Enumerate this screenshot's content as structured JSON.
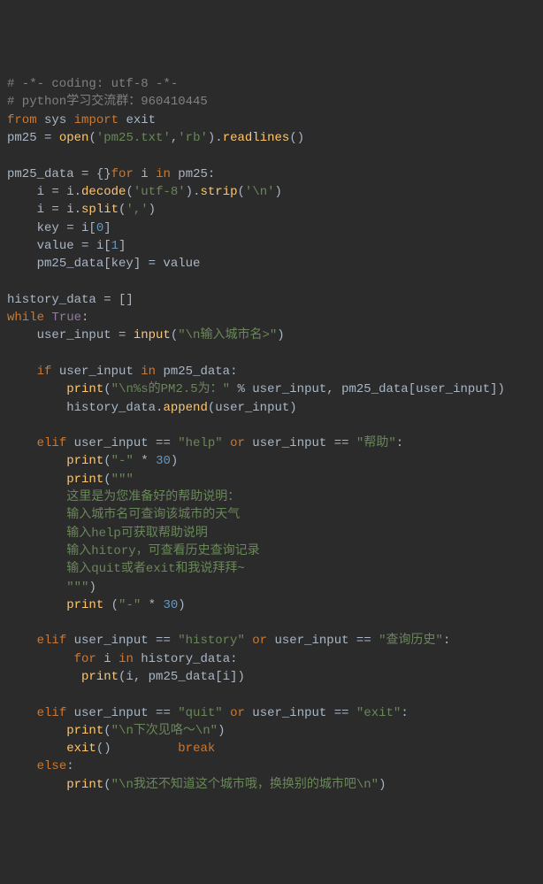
{
  "code": {
    "l01": "# -*- coding: utf-8 -*-",
    "l02": "# python学习交流群：960410445",
    "l03a": "from",
    "l03b": "sys",
    "l03c": "import",
    "l03d": "exit",
    "l04a": "pm25",
    "l04b": "=",
    "l04c": "open",
    "l04d": "'pm25.txt'",
    "l04e": ",",
    "l04f": "'rb'",
    "l04g": ").",
    "l04h": "readlines",
    "l04i": "()",
    "l06a": "pm25_data",
    "l06b": "= {}",
    "l06c": "for",
    "l06d": "i",
    "l06e": "in",
    "l06f": "pm25:",
    "l07a": "i = i.",
    "l07b": "decode",
    "l07c": "(",
    "l07d": "'utf-8'",
    "l07e": ").",
    "l07f": "strip",
    "l07g": "(",
    "l07h": "'\\n'",
    "l07i": ")",
    "l08a": "i = i.",
    "l08b": "split",
    "l08c": "(",
    "l08d": "','",
    "l08e": ")",
    "l09a": "key = i[",
    "l09b": "0",
    "l09c": "]",
    "l10a": "value = i[",
    "l10b": "1",
    "l10c": "]",
    "l11": "pm25_data[key] = value",
    "l13": "history_data = []",
    "l14a": "while",
    "l14b": "True",
    "l14c": ":",
    "l15a": "user_input = ",
    "l15b": "input",
    "l15c": "(",
    "l15d": "\"\\n输入城市名>\"",
    "l15e": ")",
    "l17a": "if",
    "l17b": "user_input",
    "l17c": "in",
    "l17d": "pm25_data:",
    "l18a": "print",
    "l18b": "(",
    "l18c": "\"\\n%s的PM2.5为：\"",
    "l18d": " % user_input, pm25_data[user_input])",
    "l19a": "history_data.",
    "l19b": "append",
    "l19c": "(user_input)",
    "l21a": "elif",
    "l21b": "user_input ==",
    "l21c": "\"help\"",
    "l21d": "or",
    "l21e": "user_input ==",
    "l21f": "\"帮助\"",
    "l21g": ":",
    "l22a": "print",
    "l22b": "(",
    "l22c": "\"-\"",
    "l22d": " * ",
    "l22e": "30",
    "l22f": ")",
    "l23a": "print",
    "l23b": "(",
    "l23c": "\"\"\"",
    "l24": "这里是为您准备好的帮助说明：",
    "l25": "输入城市名可查询该城市的天气",
    "l26": "输入help可获取帮助说明",
    "l27": "输入hitory，可查看历史查询记录",
    "l28": "输入quit或者exit和我说拜拜~",
    "l29": "\"\"\"",
    "l29b": ")",
    "l30a": "print",
    "l30b": " (",
    "l30c": "\"-\"",
    "l30d": " * ",
    "l30e": "30",
    "l30f": ")",
    "l32a": "elif",
    "l32b": "user_input ==",
    "l32c": "\"history\"",
    "l32d": "or",
    "l32e": "user_input ==",
    "l32f": "\"查询历史\"",
    "l32g": ":",
    "l33a": "for",
    "l33b": "i",
    "l33c": "in",
    "l33d": "history_data:",
    "l34a": "print",
    "l34b": "(i, pm25_data[i])",
    "l36a": "elif",
    "l36b": "user_input ==",
    "l36c": "\"quit\"",
    "l36d": "or",
    "l36e": "user_input ==",
    "l36f": "\"exit\"",
    "l36g": ":",
    "l37a": "print",
    "l37b": "(",
    "l37c": "\"\\n下次见咯～\\n\"",
    "l37d": ")",
    "l38a": "exit",
    "l38b": "()",
    "l38c": "break",
    "l39a": "else",
    "l39b": ":",
    "l40a": "print",
    "l40b": "(",
    "l40c": "\"\\n我还不知道这个城市哦，换换别的城市吧\\n\"",
    "l40d": ")"
  }
}
